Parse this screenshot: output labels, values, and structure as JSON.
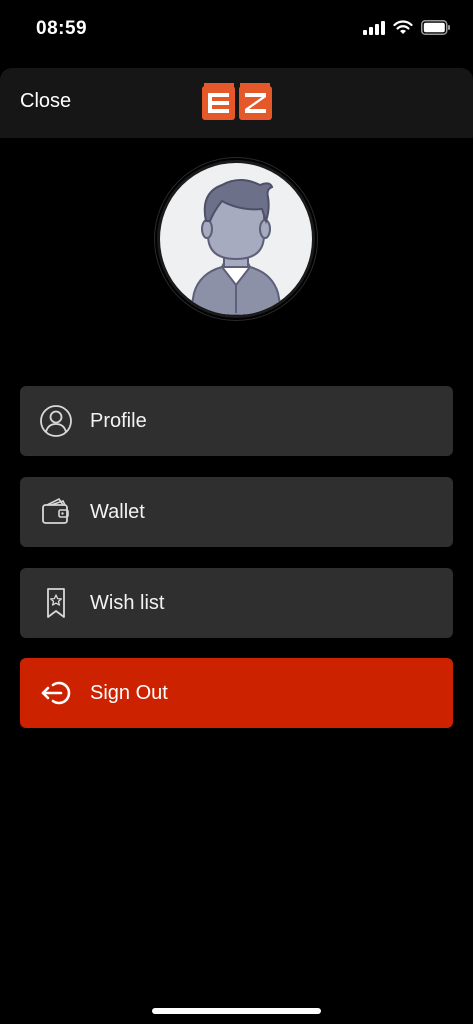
{
  "status_bar": {
    "time": "08:59",
    "icons": [
      "cellular-signal-icon",
      "wifi-icon",
      "battery-icon"
    ]
  },
  "header": {
    "close_label": "Close",
    "logo_text": "EZ",
    "brand_color": "#e4582a"
  },
  "profile": {
    "avatar_icon": "user-avatar-icon"
  },
  "menu": {
    "items": [
      {
        "label": "Profile",
        "icon": "user-circle-icon"
      },
      {
        "label": "Wallet",
        "icon": "wallet-icon"
      },
      {
        "label": "Wish list",
        "icon": "bookmark-star-icon"
      },
      {
        "label": "Sign Out",
        "icon": "sign-out-icon",
        "color": "#cc2200"
      }
    ]
  }
}
